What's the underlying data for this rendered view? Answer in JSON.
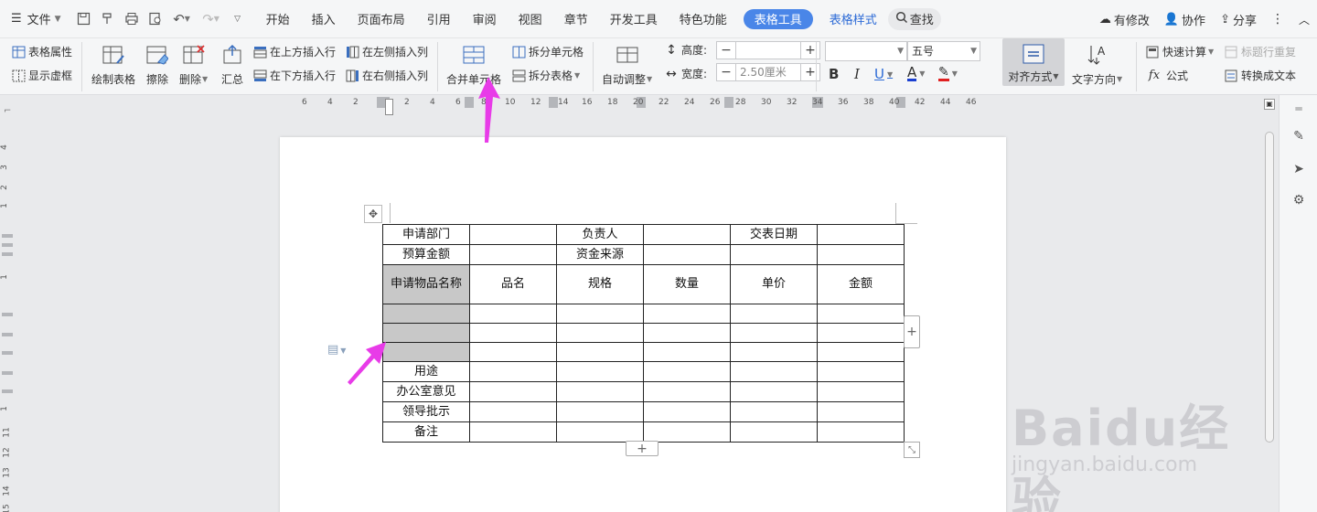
{
  "menubar": {
    "file": "文件",
    "tabs": [
      "开始",
      "插入",
      "页面布局",
      "引用",
      "审阅",
      "视图",
      "章节",
      "开发工具",
      "特色功能"
    ],
    "active_tab": "表格工具",
    "tab_table_style": "表格样式",
    "search": "查找",
    "modified": "有修改",
    "collab": "协作",
    "share": "分享"
  },
  "ribbon": {
    "table_props": "表格属性",
    "show_gridlines": "显示虚框",
    "draw_table": "绘制表格",
    "erase": "擦除",
    "delete": "删除",
    "summary": "汇总",
    "insert_above": "在上方插入行",
    "insert_below": "在下方插入行",
    "insert_left": "在左侧插入列",
    "insert_right": "在右侧插入列",
    "merge_cells": "合并单元格",
    "split_cells": "拆分单元格",
    "split_table": "拆分表格",
    "auto_fit": "自动调整",
    "height_label": "高度:",
    "height_value": "",
    "width_label": "宽度:",
    "width_value": "2.50厘米",
    "font_name": "",
    "font_size": "五号",
    "align": "对齐方式",
    "text_dir": "文字方向",
    "quick_calc": "快速计算",
    "formula": "公式",
    "repeat_header": "标题行重复",
    "to_text": "转换成文本"
  },
  "ruler": {
    "h_ticks": [
      "6",
      "4",
      "2",
      "2",
      "4",
      "6",
      "8",
      "10",
      "12",
      "14",
      "16",
      "18",
      "20",
      "22",
      "24",
      "26",
      "28",
      "30",
      "32",
      "34",
      "36",
      "38",
      "40",
      "42",
      "44",
      "46"
    ],
    "v_ticks": [
      "4",
      "3",
      "2",
      "1",
      "1",
      "3",
      "1",
      "11",
      "12",
      "13",
      "14",
      "15"
    ]
  },
  "table": {
    "rows": [
      [
        "申请部门",
        "",
        "负责人",
        "",
        "交表日期",
        ""
      ],
      [
        "预算金额",
        "",
        "资金来源",
        "",
        "",
        ""
      ],
      [
        "申请物品名称",
        "品名",
        "规格",
        "数量",
        "单价",
        "金额"
      ],
      [
        "",
        "",
        "",
        "",
        "",
        ""
      ],
      [
        "",
        "",
        "",
        "",
        "",
        ""
      ],
      [
        "",
        "",
        "",
        "",
        "",
        ""
      ],
      [
        "用途",
        "",
        "",
        "",
        "",
        ""
      ],
      [
        "办公室意见",
        "",
        "",
        "",
        "",
        ""
      ],
      [
        "领导批示",
        "",
        "",
        "",
        "",
        ""
      ],
      [
        "备注",
        "",
        "",
        "",
        "",
        ""
      ]
    ]
  },
  "watermark": {
    "brand": "Baidu经验",
    "url": "jingyan.baidu.com"
  },
  "colors": {
    "accent": "#4a86e8",
    "arrow": "#e83be8",
    "selected_cell": "#c8c8c8"
  }
}
